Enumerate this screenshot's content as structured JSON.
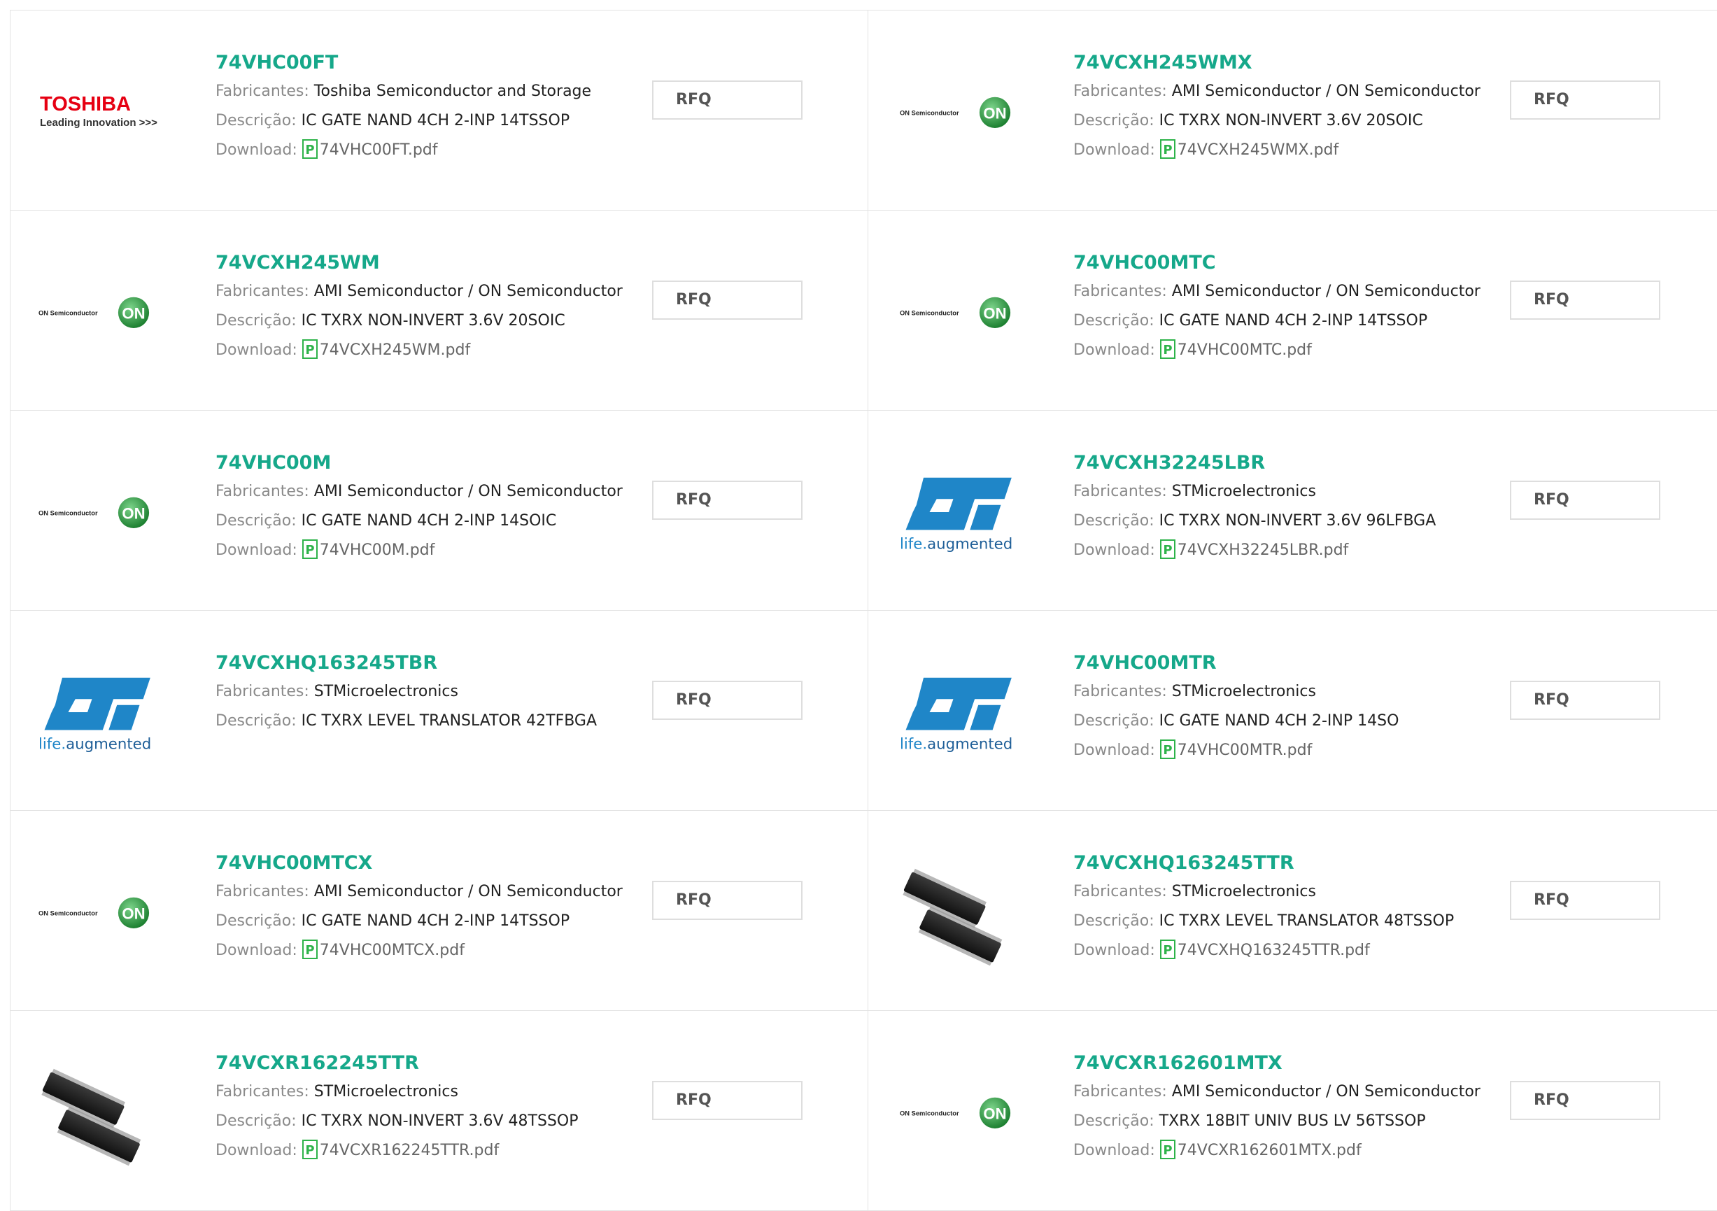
{
  "labels": {
    "manufacturer": "Fabricantes:",
    "description": "Descrição:",
    "download": "Download:",
    "rfq": "RFQ"
  },
  "logos": {
    "toshiba_name": "TOSHIBA",
    "toshiba_tagline": "Leading Innovation >>>",
    "onsemi_name": "ON Semiconductor",
    "onsemi_badge": "ON",
    "st_tagline_a": "life.",
    "st_tagline_b": "augmented"
  },
  "products": [
    {
      "part": "74VHC00FT",
      "manufacturer": "Toshiba Semiconductor and Storage",
      "description": "IC GATE NAND 4CH 2-INP 14TSSOP",
      "file": "74VHC00FT.pdf",
      "logo": "toshiba-logo"
    },
    {
      "part": "74VCXH245WMX",
      "manufacturer": "AMI Semiconductor / ON Semiconductor",
      "description": "IC TXRX NON-INVERT 3.6V 20SOIC",
      "file": "74VCXH245WMX.pdf",
      "logo": "onsemi-logo"
    },
    {
      "part": "74VCXH245WM",
      "manufacturer": "AMI Semiconductor / ON Semiconductor",
      "description": "IC TXRX NON-INVERT 3.6V 20SOIC",
      "file": "74VCXH245WM.pdf",
      "logo": "onsemi-logo"
    },
    {
      "part": "74VHC00MTC",
      "manufacturer": "AMI Semiconductor / ON Semiconductor",
      "description": "IC GATE NAND 4CH 2-INP 14TSSOP",
      "file": "74VHC00MTC.pdf",
      "logo": "onsemi-logo"
    },
    {
      "part": "74VHC00M",
      "manufacturer": "AMI Semiconductor / ON Semiconductor",
      "description": "IC GATE NAND 4CH 2-INP 14SOIC",
      "file": "74VHC00M.pdf",
      "logo": "onsemi-logo"
    },
    {
      "part": "74VCXH32245LBR",
      "manufacturer": "STMicroelectronics",
      "description": "IC TXRX NON-INVERT 3.6V 96LFBGA",
      "file": "74VCXH32245LBR.pdf",
      "logo": "st-logo"
    },
    {
      "part": "74VCXHQ163245TBR",
      "manufacturer": "STMicroelectronics",
      "description": "IC TXRX LEVEL TRANSLATOR 42TFBGA",
      "file": null,
      "logo": "st-logo"
    },
    {
      "part": "74VHC00MTR",
      "manufacturer": "STMicroelectronics",
      "description": "IC GATE NAND 4CH 2-INP 14SO",
      "file": "74VHC00MTR.pdf",
      "logo": "st-logo"
    },
    {
      "part": "74VHC00MTCX",
      "manufacturer": "AMI Semiconductor / ON Semiconductor",
      "description": "IC GATE NAND 4CH 2-INP 14TSSOP",
      "file": "74VHC00MTCX.pdf",
      "logo": "onsemi-logo"
    },
    {
      "part": "74VCXHQ163245TTR",
      "manufacturer": "STMicroelectronics",
      "description": "IC TXRX LEVEL TRANSLATOR 48TSSOP",
      "file": "74VCXHQ163245TTR.pdf",
      "logo": "chip-photo"
    },
    {
      "part": "74VCXR162245TTR",
      "manufacturer": "STMicroelectronics",
      "description": "IC TXRX NON-INVERT 3.6V 48TSSOP",
      "file": "74VCXR162245TTR.pdf",
      "logo": "chip-photo"
    },
    {
      "part": "74VCXR162601MTX",
      "manufacturer": "AMI Semiconductor / ON Semiconductor",
      "description": "TXRX 18BIT UNIV BUS LV 56TSSOP",
      "file": "74VCXR162601MTX.pdf",
      "logo": "onsemi-logo"
    }
  ],
  "colors": {
    "part_link": "#16a88a",
    "toshiba_red": "#e60012",
    "onsemi_green": "#2e9e3f",
    "st_blue": "#1f86c8",
    "pdf_green": "#2eb34a"
  }
}
